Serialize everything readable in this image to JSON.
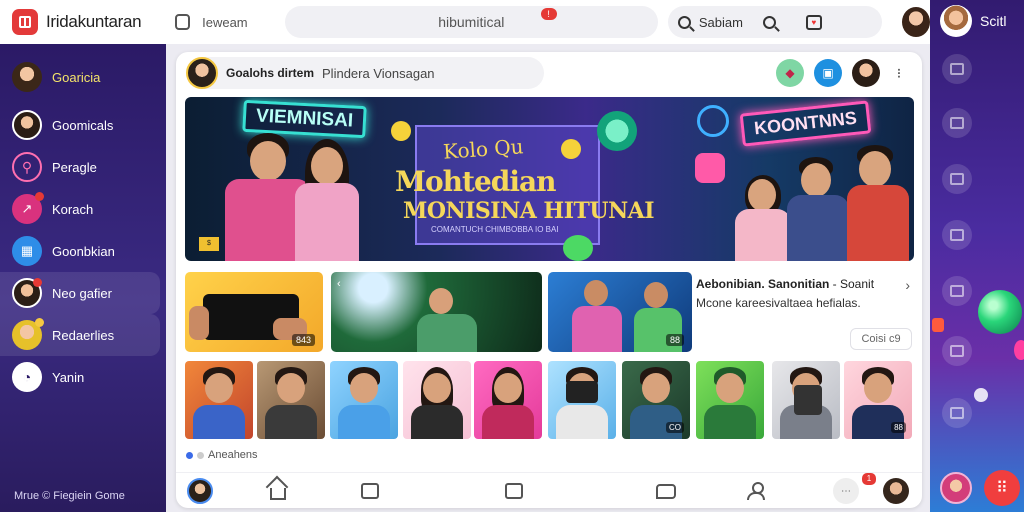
{
  "app": {
    "name": "Iridakuntaran"
  },
  "topbar": {
    "left_text": "Ieweam",
    "search_text": "hibumitical",
    "search_badge": "!",
    "search_pill_label": "Sabiam"
  },
  "sidebar": {
    "items": [
      {
        "label": "Goaricia",
        "active": true
      },
      {
        "label": "Goomicals",
        "active": false
      },
      {
        "label": "Peragle",
        "active": false
      },
      {
        "label": "Korach",
        "active": false
      },
      {
        "label": "Goonbkian",
        "active": false
      },
      {
        "label": "Neo gafier",
        "active": false
      },
      {
        "label": "Redaerlies",
        "active": false
      },
      {
        "label": "Yanin",
        "active": false
      }
    ],
    "footer": "Mrue  © Fiegiein Gome"
  },
  "rail": {
    "user_label": "Scitl"
  },
  "post": {
    "author": "Goalohs dirtem",
    "subtitle": "Plindera Vionsagan"
  },
  "hero": {
    "neon_left": "VIEMNISAI",
    "neon_right": "KOONTNNS",
    "line1": "Kolo Qu",
    "line2": "Mohtedian",
    "line3": "MONISINA HITUNAI",
    "line4": "COMANTUCH CHIMBOBBA IO BAI"
  },
  "thumbs": [
    {
      "badge": "843"
    },
    {
      "badge": ""
    },
    {
      "badge": "88"
    }
  ],
  "news": {
    "title_bold": "Aebonibian. Sanonitian",
    "title_rest": " - Soanit",
    "subtitle": "Mcone kareesivaltaea hefialas.",
    "button": "Coisi c9"
  },
  "small_thumbs": [
    {
      "badge": ""
    },
    {
      "badge": ""
    },
    {
      "badge": ""
    },
    {
      "badge": ""
    },
    {
      "badge": ""
    },
    {
      "badge": ""
    },
    {
      "badge": "CO"
    },
    {
      "badge": ""
    },
    {
      "badge": ""
    },
    {
      "badge": "88"
    }
  ],
  "pager_label": "Aneahens",
  "bottom_nav": {
    "notif_badge": "1"
  },
  "colors": {
    "accent": "#e33a3a",
    "sidebar_bg": "#2b1a66",
    "active_label": "#f5e46a",
    "badge_red": "#e53935"
  }
}
